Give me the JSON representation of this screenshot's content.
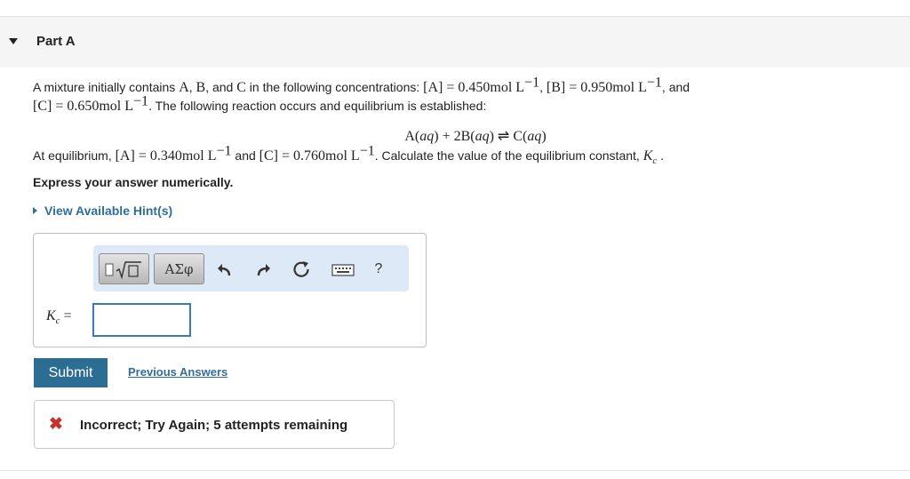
{
  "part": {
    "title": "Part A"
  },
  "problem": {
    "intro": "A mixture initially contains",
    "species_a": "A",
    "comma1": ",",
    "species_b": "B",
    "and1": ", and",
    "species_c": "C",
    "in_following": "in the following concentrations:",
    "conc_a_label": "[A] = ",
    "conc_a_value": "0.450mol L",
    "exp": "−1",
    "sep1": ", ",
    "conc_b_label": "[B] = ",
    "conc_b_value": "0.950mol L",
    "and2": ", and",
    "conc_c_label": "[C] = ",
    "conc_c_value": "0.650mol L",
    "reaction_sentence": ". The following reaction occurs and equilibrium is established:"
  },
  "reaction": {
    "a": "A(",
    "aq": "aq",
    "close": ")",
    "plus": " + 2B(",
    "arrow": " ⇌ C("
  },
  "equilibrium": {
    "at_eq": "At equilibrium,",
    "eq_a_label": "[A] = ",
    "eq_a_value": "0.340mol L",
    "and": "and",
    "eq_c_label": "[C] = ",
    "eq_c_value": "0.760mol L",
    "calc": ". Calculate the value of the equilibrium constant,",
    "k": "K",
    "c": "c",
    "period": "."
  },
  "instruction": "Express your answer numerically.",
  "hints_label": "View Available Hint(s)",
  "toolbar": {
    "symbols_label": "ΑΣφ",
    "help_label": "?"
  },
  "answer": {
    "k": "K",
    "c": "c",
    "equals": " =",
    "value": ""
  },
  "submit_label": "Submit",
  "previous_answers_label": "Previous Answers",
  "feedback": {
    "icon": "✖",
    "text": "Incorrect; Try Again; 5 attempts remaining"
  },
  "colors": {
    "link": "#2e6e9e",
    "submit_bg": "#2c6d94",
    "error": "#c9302c",
    "input_border": "#3a78c3",
    "toolbar_bg": "#dde9f7"
  },
  "icons": [
    "caret-down-icon",
    "templates-icon",
    "undo-icon",
    "redo-icon",
    "reset-icon",
    "keyboard-icon",
    "help-icon",
    "error-x-icon",
    "hint-caret-icon"
  ]
}
